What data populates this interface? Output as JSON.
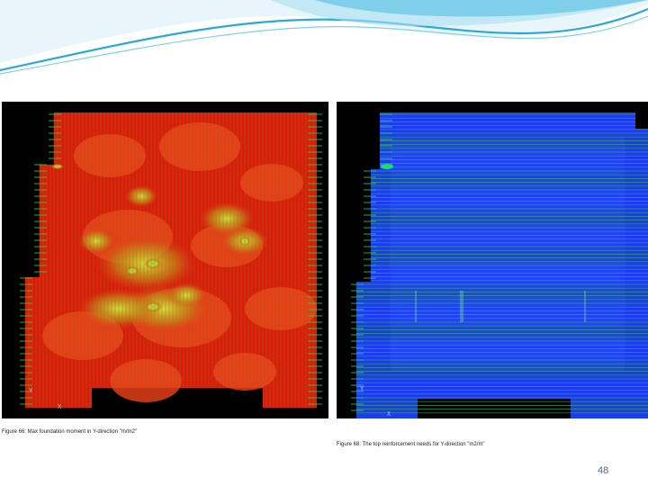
{
  "slide": {
    "page_number": "48",
    "accent_color": "#2aa9d8"
  },
  "figures": [
    {
      "id": "left",
      "caption": "Figure 66: Max foundation moment in Y-direction \"m/m2\"",
      "colormap": [
        "#e0180a",
        "#f0441a",
        "#c98a1a",
        "#d6e03a",
        "#19e06a",
        "#1aa0ff"
      ],
      "axis_x": "X",
      "axis_y": "Y"
    },
    {
      "id": "right",
      "caption": "Figure 68: The top reinforcement needs for Y-direction \"m2/m\"",
      "colormap": [
        "#1a3cf2",
        "#2a52ff",
        "#19e06a"
      ],
      "axis_x": "X",
      "axis_y": "Y"
    }
  ]
}
